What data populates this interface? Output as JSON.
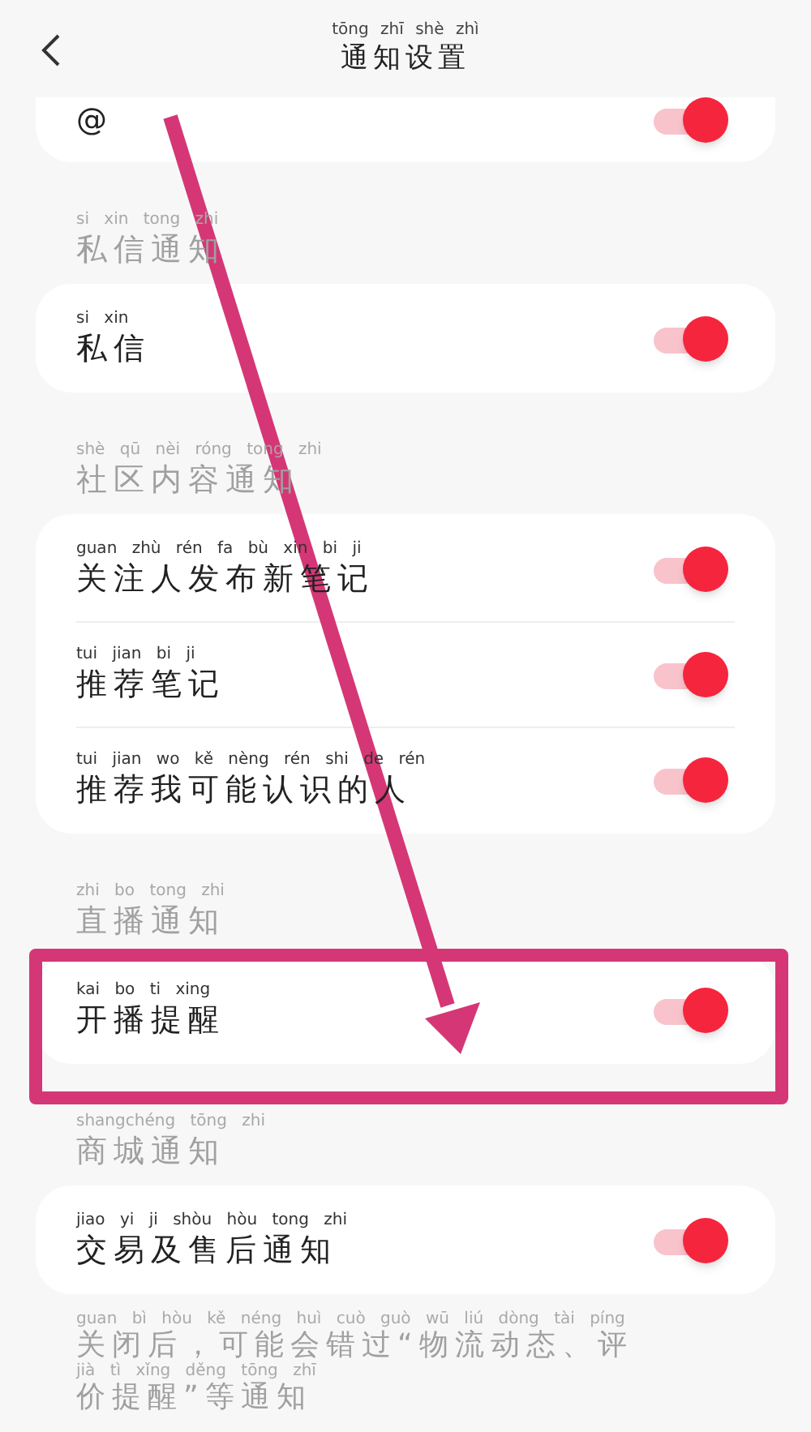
{
  "header": {
    "title": "通知设置",
    "title_pinyin": "tōng zhī shè zhì"
  },
  "sections": [
    {
      "items": [
        {
          "label": "@",
          "on": true
        }
      ]
    },
    {
      "title": "私信通知",
      "title_pinyin": "si xin tong zhi",
      "items": [
        {
          "label": "私信",
          "pinyin": "si xin",
          "on": true
        }
      ]
    },
    {
      "title": "社区内容通知",
      "title_pinyin": "shè qū nèi róng tong zhi",
      "items": [
        {
          "label": "关注人发布新笔记",
          "pinyin": "guan zhù rén fa bù xin bi ji",
          "on": true
        },
        {
          "label": "推荐笔记",
          "pinyin": "tui jian bi ji",
          "on": true
        },
        {
          "label": "推荐我可能认识的人",
          "pinyin": "tui jian wo kě nèng rén shi de rén",
          "on": true
        }
      ]
    },
    {
      "title": "直播通知",
      "title_pinyin": "zhi bo tong zhi",
      "items": [
        {
          "label": "开播提醒",
          "pinyin": "kai bo ti xing",
          "on": true
        }
      ]
    },
    {
      "title": "商城通知",
      "title_pinyin": "shangchéng tōng zhi",
      "items": [
        {
          "label": "交易及售后通知",
          "pinyin": "jiao yi ji shòu hòu tong zhi",
          "on": true
        }
      ]
    }
  ],
  "footer_note": [
    {
      "text": "关闭后，可能会错过“物流动态、评",
      "pinyin": "guan bì hòu kě néng huì cuò guò wū liú dòng tài píng"
    },
    {
      "text": "价提醒”等通知",
      "pinyin": "jià tì xǐng děng tōng zhī"
    }
  ],
  "annotations": {
    "arrow": true,
    "highlight_frame": true
  }
}
